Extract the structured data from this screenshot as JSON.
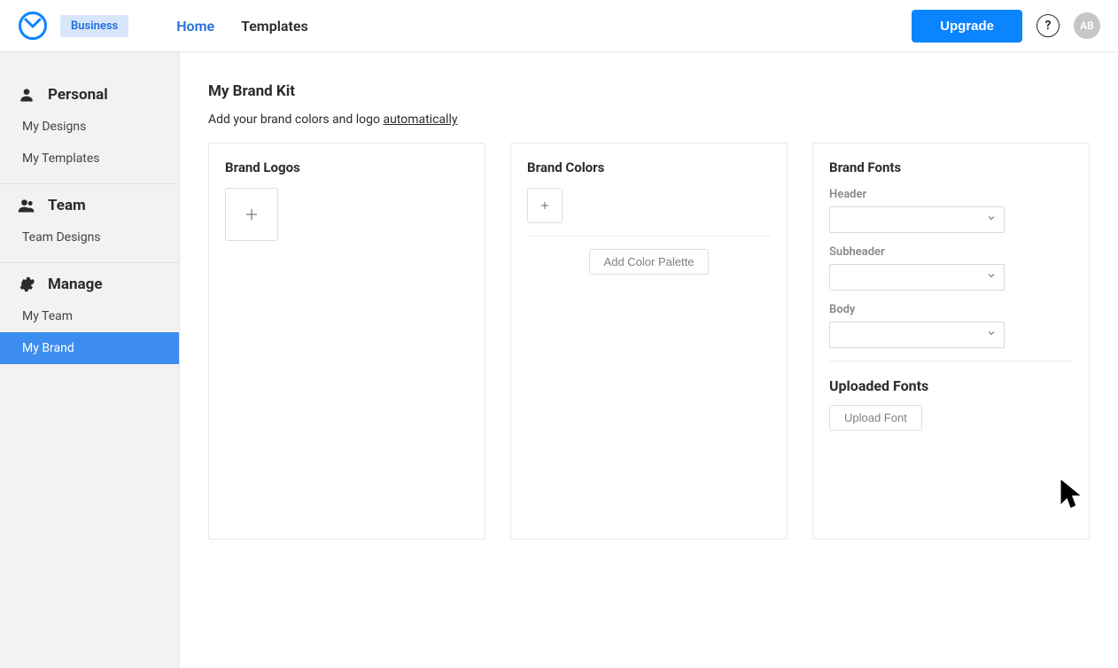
{
  "header": {
    "badge": "Business",
    "nav": {
      "home": "Home",
      "templates": "Templates"
    },
    "upgrade": "Upgrade",
    "avatar_initials": "AB"
  },
  "sidebar": {
    "personal": {
      "heading": "Personal",
      "items": [
        "My Designs",
        "My Templates"
      ]
    },
    "team": {
      "heading": "Team",
      "items": [
        "Team Designs"
      ]
    },
    "manage": {
      "heading": "Manage",
      "items": [
        "My Team",
        "My Brand"
      ],
      "active_index": 1
    }
  },
  "page": {
    "title": "My Brand Kit",
    "subtitle_prefix": "Add your brand colors and logo ",
    "subtitle_link": "automatically"
  },
  "logos": {
    "title": "Brand Logos"
  },
  "colors": {
    "title": "Brand Colors",
    "add_palette": "Add Color Palette"
  },
  "fonts": {
    "title": "Brand Fonts",
    "labels": {
      "header": "Header",
      "subheader": "Subheader",
      "body": "Body"
    },
    "uploaded_title": "Uploaded Fonts",
    "upload_btn": "Upload Font"
  }
}
